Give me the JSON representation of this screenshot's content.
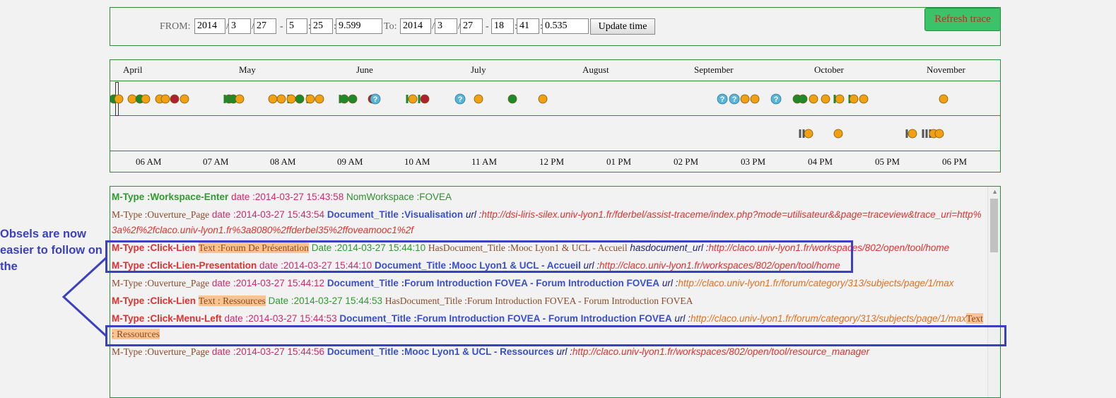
{
  "range": {
    "from_label": "FROM:",
    "to_label": "To:",
    "from": {
      "year": "2014",
      "month": "3",
      "day": "27",
      "hour": "5",
      "minute": "25",
      "second": "9.599"
    },
    "to": {
      "year": "2014",
      "month": "3",
      "day": "27",
      "hour": "18",
      "minute": "41",
      "second": "0.535"
    },
    "sep_slash": "/",
    "sep_dash": "-",
    "sep_colon": ":",
    "update_label": "Update time",
    "refresh_label": "Refresh trace"
  },
  "timeline": {
    "months": [
      "April",
      "May",
      "June",
      "July",
      "August",
      "September",
      "October",
      "November"
    ],
    "hours": [
      "06 AM",
      "07 AM",
      "08 AM",
      "09 AM",
      "10 AM",
      "11 AM",
      "12 PM",
      "01 PM",
      "02 PM",
      "03 PM",
      "04 PM",
      "05 PM",
      "06 PM"
    ],
    "colors": {
      "orange": "#f0a010",
      "green": "#1a8a2a",
      "red": "#b02030",
      "question": "#5ab4d8"
    }
  },
  "trace": {
    "rows": [
      {
        "type": "M-Type :Workspace-Enter",
        "date_label": "date :",
        "date": "2014-03-27 15:43:58",
        "k1": "NomWorkspace :",
        "v1": "FOVEA"
      },
      {
        "type": "M-Type :Ouverture_Page",
        "date_label": "date :",
        "date": "2014-03-27 15:43:54",
        "k1": "Document_Title :",
        "v1": "Visualisation",
        "url_label": "url :",
        "url": "http://dsi-liris-silex.univ-lyon1.fr/fderbel/assist-traceme/index.php?mode=utilisateur&&page=traceview&trace_uri=http%3a%2f%2fclaco.univ-lyon1.fr%3a8080%2ffderbel35%2ffoveamooc1%2f"
      },
      {
        "type": "M-Type :Click-Lien",
        "text": "Text :Forum De Présentation",
        "date_label": "Date :",
        "date": "2014-03-27 15:44:10",
        "k1": "HasDocument_Title :",
        "v1": "Mooc Lyon1 & UCL - Accueil",
        "url_label": "hasdocument_url :",
        "url": "http://claco.univ-lyon1.fr/workspaces/802/open/tool/home"
      },
      {
        "type": "M-Type :Click-Lien-Presentation",
        "date_label": "date :",
        "date": "2014-03-27 15:44:10",
        "k1": "Document_Title :",
        "v1": "Mooc Lyon1 & UCL - Accueil",
        "url_label": "url :",
        "url": "http://claco.univ-lyon1.fr/workspaces/802/open/tool/home"
      },
      {
        "type": "M-Type :Ouverture_Page",
        "date_label": "date :",
        "date": "2014-03-27 15:44:12",
        "k1": "Document_Title :",
        "v1": "Forum Introduction FOVEA - Forum Introduction FOVEA",
        "url_label": "url :",
        "url": "http://claco.univ-lyon1.fr/forum/category/313/subjects/page/1/max"
      },
      {
        "type": "M-Type :Click-Lien",
        "text": "Text : Ressources",
        "date_label": "Date :",
        "date": "2014-03-27 15:44:53",
        "k1": "HasDocument_Title :",
        "v1": "Forum Introduction FOVEA - Forum Introduction FOVEA"
      },
      {
        "type": "M-Type :Click-Menu-Left",
        "date_label": "date :",
        "date": "2014-03-27 15:44:53",
        "k1": "Document_Title :",
        "v1": "Forum Introduction FOVEA - Forum Introduction FOVEA",
        "url_label": "url :",
        "url": "http://claco.univ-lyon1.fr/forum/category/313/subjects/page/1/max",
        "text": "Text : Ressources"
      },
      {
        "type": "M-Type :Ouverture_Page",
        "date_label": "date :",
        "date": "2014-03-27 15:44:56",
        "k1": "Document_Title :",
        "v1": "Mooc Lyon1 & UCL - Ressources",
        "url_label": "url :",
        "url": "http://claco.univ-lyon1.fr/workspaces/802/open/tool/resource_manager"
      }
    ]
  },
  "annotation": {
    "text": "Obsels are now easier to follow on the",
    "color": "#3a40c0"
  }
}
